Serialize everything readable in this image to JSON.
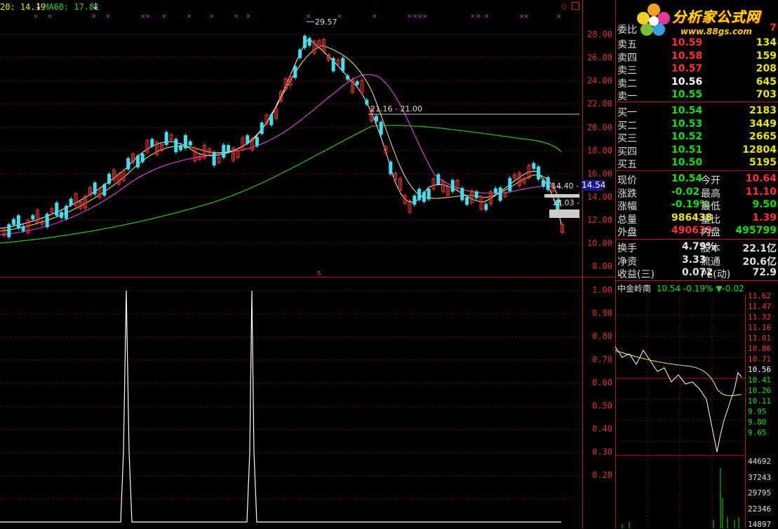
{
  "indicators": {
    "ma20": "20: 14.19",
    "ma60": "MA60: 17.81"
  },
  "main_axis": {
    "ticks": [
      "28.00",
      "26.00",
      "24.00",
      "22.00",
      "20.00",
      "18.00",
      "16.00",
      "14.00",
      "12.00",
      "10.00",
      "8.00"
    ]
  },
  "osc_axis": {
    "ticks": [
      "1.00",
      "0.90",
      "0.80",
      "0.70",
      "0.60",
      "0.50",
      "0.40",
      "0.30",
      "0.20"
    ]
  },
  "annotations": {
    "peak": "29.57",
    "range": "21.16 - 21.00",
    "price_tag": "14.54",
    "cross_label": "14.40 - 1",
    "low_label": "13.03 -",
    "low_dot": "-",
    "s_marker": "s"
  },
  "logo": {
    "text": "分析家公式网",
    "url": "www.88gs.com"
  },
  "quote": {
    "weibi_label": "委比",
    "weibi_value": "7",
    "asks": [
      {
        "label": "卖五",
        "price": "10.59",
        "vol": "134"
      },
      {
        "label": "卖四",
        "price": "10.58",
        "vol": "159"
      },
      {
        "label": "卖三",
        "price": "10.57",
        "vol": "208"
      },
      {
        "label": "卖二",
        "price": "10.56",
        "vol": "645"
      },
      {
        "label": "卖一",
        "price": "10.55",
        "vol": "703"
      }
    ],
    "bids": [
      {
        "label": "买一",
        "price": "10.54",
        "vol": "2183"
      },
      {
        "label": "买二",
        "price": "10.53",
        "vol": "3449"
      },
      {
        "label": "买三",
        "price": "10.52",
        "vol": "2665"
      },
      {
        "label": "买四",
        "price": "10.51",
        "vol": "12804"
      },
      {
        "label": "买五",
        "price": "10.50",
        "vol": "5195"
      }
    ],
    "stats": [
      {
        "l1": "现价",
        "v1": "10.54",
        "l2": "今开",
        "v2": "10.64",
        "c1": "#10e010",
        "c2": "#ff3030"
      },
      {
        "l1": "涨跌",
        "v1": "-0.02",
        "l2": "最高",
        "v2": "11.10",
        "c1": "#10e010",
        "c2": "#ff3030"
      },
      {
        "l1": "涨幅",
        "v1": "-0.19%",
        "l2": "最低",
        "v2": "9.50",
        "c1": "#10e010",
        "c2": "#10e010"
      },
      {
        "l1": "总量",
        "v1": "986438",
        "l2": "量比",
        "v2": "1.39",
        "c1": "#e8e800",
        "c2": "#ff3030"
      },
      {
        "l1": "外盘",
        "v1": "490639",
        "l2": "内盘",
        "v2": "495799",
        "c1": "#ff3030",
        "c2": "#10e010"
      }
    ],
    "fin": [
      {
        "l1": "换手",
        "v1": "4.79%",
        "l2": "股本",
        "v2": "22.1亿"
      },
      {
        "l1": "净资",
        "v1": "3.33",
        "l2": "流通",
        "v2": "20.6亿"
      },
      {
        "l1": "收益(三)",
        "v1": "0.072",
        "l2": "PE(动)",
        "v2": "72.9"
      }
    ]
  },
  "mini": {
    "name": "中金岭南",
    "price": "10.54",
    "pct": "-0.19%",
    "change": "▼-0.02",
    "price_ticks": [
      {
        "v": "11.62",
        "c": "#ff3030"
      },
      {
        "v": "11.47",
        "c": "#ff3030"
      },
      {
        "v": "11.32",
        "c": "#ff3030"
      },
      {
        "v": "11.16",
        "c": "#ff3030"
      },
      {
        "v": "11.01",
        "c": "#ff3030"
      },
      {
        "v": "10.86",
        "c": "#ff3030"
      },
      {
        "v": "10.71",
        "c": "#ff3030"
      },
      {
        "v": "10.56",
        "c": "#ffffff"
      },
      {
        "v": "10.41",
        "c": "#10e010"
      },
      {
        "v": "10.26",
        "c": "#10e010"
      },
      {
        "v": "10.11",
        "c": "#10e010"
      },
      {
        "v": "9.95",
        "c": "#10e010"
      },
      {
        "v": "9.80",
        "c": "#10e010"
      },
      {
        "v": "9.65",
        "c": "#10e010"
      }
    ],
    "vol_ticks": [
      "44692",
      "37243",
      "29795",
      "22346",
      "14897"
    ]
  }
}
